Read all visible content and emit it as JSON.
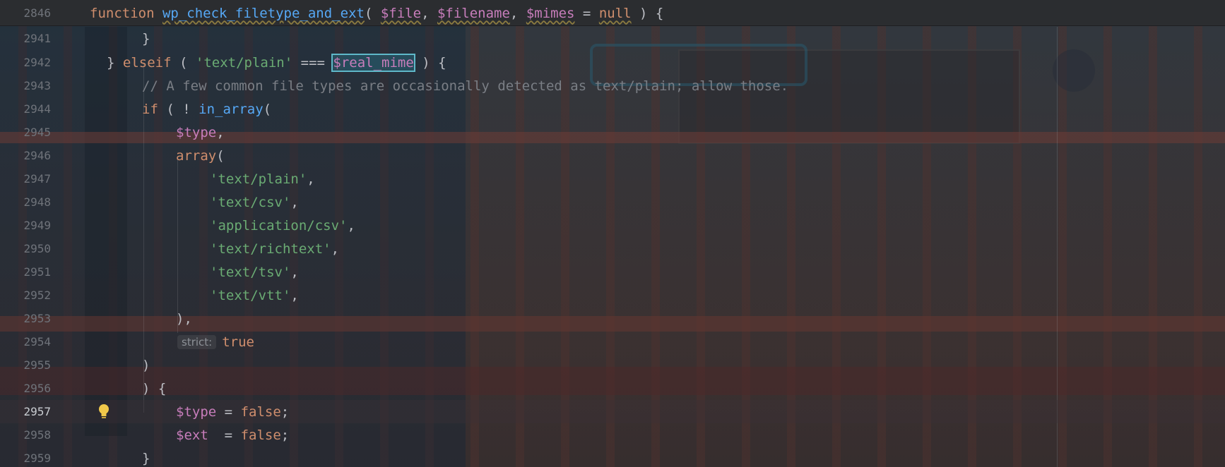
{
  "sticky": {
    "line_number": "2846",
    "keyword": "function",
    "name": "wp_check_filetype_and_ext",
    "open_paren": "(",
    "param1": "$file",
    "comma1": ",",
    "param2": "$filename",
    "comma2": ",",
    "param3": "$mimes",
    "assign": "=",
    "null_kw": "null",
    "close": ") {"
  },
  "lines": {
    "l2941": {
      "num": "2941",
      "text": "}"
    },
    "l2942": {
      "num": "2942",
      "brace": "}",
      "elseif": "elseif",
      "paren_open": "(",
      "str": "'text/plain'",
      "op": "===",
      "var": "$real_mime",
      "tail": ") {"
    },
    "l2943": {
      "num": "2943",
      "comment": "// A few common file types are occasionally detected as text/plain; allow those."
    },
    "l2944": {
      "num": "2944",
      "if_kw": "if",
      "paren": "( !",
      "fn": "in_array",
      "open": "("
    },
    "l2945": {
      "num": "2945",
      "var": "$type",
      "comma": ","
    },
    "l2946": {
      "num": "2946",
      "array_kw": "array",
      "open": "("
    },
    "l2947": {
      "num": "2947",
      "str": "'text/plain'",
      "comma": ","
    },
    "l2948": {
      "num": "2948",
      "str": "'text/csv'",
      "comma": ","
    },
    "l2949": {
      "num": "2949",
      "str": "'application/csv'",
      "comma": ","
    },
    "l2950": {
      "num": "2950",
      "str": "'text/richtext'",
      "comma": ","
    },
    "l2951": {
      "num": "2951",
      "str": "'text/tsv'",
      "comma": ","
    },
    "l2952": {
      "num": "2952",
      "str": "'text/vtt'",
      "comma": ","
    },
    "l2953": {
      "num": "2953",
      "text": "),"
    },
    "l2954": {
      "num": "2954",
      "hint": "strict:",
      "value": "true"
    },
    "l2955": {
      "num": "2955",
      "text": ")"
    },
    "l2956": {
      "num": "2956",
      "text": ") {"
    },
    "l2957": {
      "num": "2957",
      "var": "$type",
      "assign": "=",
      "value": "false",
      "semi": ";"
    },
    "l2958": {
      "num": "2958",
      "var": "$ext",
      "assign": "=",
      "value": "false",
      "semi": ";"
    },
    "l2959": {
      "num": "2959",
      "text": "}"
    }
  },
  "icons": {
    "intention": "lightbulb-icon"
  },
  "colors": {
    "keyword": "#cf8e6d",
    "function": "#56a8f5",
    "variable": "#c77dbb",
    "string": "#6aab73",
    "comment": "#7a7e85",
    "highlight_box": "#5fb8c9",
    "bulb": "#f0c84a"
  }
}
